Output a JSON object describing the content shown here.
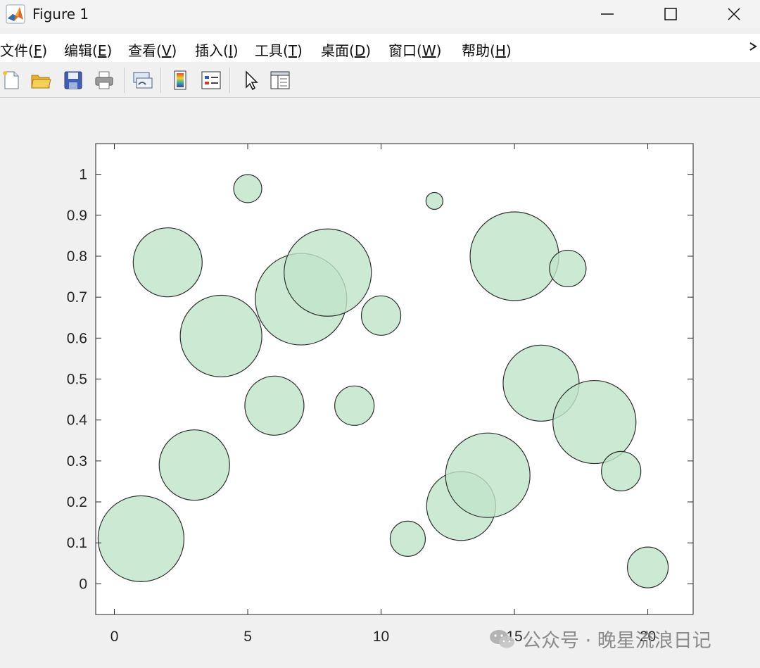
{
  "window": {
    "title": "Figure 1"
  },
  "menu": [
    {
      "label": "文件(",
      "acc": "F",
      "tail": ")"
    },
    {
      "label": "编辑(",
      "acc": "E",
      "tail": ")"
    },
    {
      "label": "查看(",
      "acc": "V",
      "tail": ")"
    },
    {
      "label": "插入(",
      "acc": "I",
      "tail": ")"
    },
    {
      "label": "工具(",
      "acc": "T",
      "tail": ")"
    },
    {
      "label": "桌面(",
      "acc": "D",
      "tail": ")"
    },
    {
      "label": "窗口(",
      "acc": "W",
      "tail": ")"
    },
    {
      "label": "帮助(",
      "acc": "H",
      "tail": ")"
    }
  ],
  "toolbar_icons": [
    "new-figure-icon",
    "open-file-icon",
    "save-icon",
    "print-icon",
    "link-plot-icon",
    "colorbar-icon",
    "legend-icon",
    "pointer-icon",
    "property-editor-icon"
  ],
  "watermark": "公众号 · 晚星流浪日记",
  "colors": {
    "bubble_fill": "#bfe3c9",
    "bubble_edge": "#1a1a1a",
    "axes_bg": "#ffffff",
    "figure_bg": "#f0f0f0"
  },
  "chart_data": {
    "type": "scatter",
    "title": "",
    "xlabel": "",
    "ylabel": "",
    "xlim": [
      -0.7,
      21.7
    ],
    "ylim": [
      -0.075,
      1.075
    ],
    "xticks": [
      0,
      5,
      10,
      15,
      20
    ],
    "yticks": [
      0,
      0.1,
      0.2,
      0.3,
      0.4,
      0.5,
      0.6,
      0.7,
      0.8,
      0.9,
      1
    ],
    "ytick_labels": [
      "0",
      "0.1",
      "0.2",
      "0.3",
      "0.4",
      "0.5",
      "0.6",
      "0.7",
      "0.8",
      "0.9",
      "1"
    ],
    "grid": false,
    "marker_alpha": 0.8,
    "points": [
      {
        "x": 1,
        "y": 0.11,
        "size": 61
      },
      {
        "x": 2,
        "y": 0.785,
        "size": 49
      },
      {
        "x": 3,
        "y": 0.29,
        "size": 50
      },
      {
        "x": 4,
        "y": 0.605,
        "size": 58
      },
      {
        "x": 5,
        "y": 0.965,
        "size": 20
      },
      {
        "x": 6,
        "y": 0.435,
        "size": 42
      },
      {
        "x": 7,
        "y": 0.695,
        "size": 65
      },
      {
        "x": 8,
        "y": 0.76,
        "size": 62
      },
      {
        "x": 9,
        "y": 0.435,
        "size": 28
      },
      {
        "x": 10,
        "y": 0.655,
        "size": 28
      },
      {
        "x": 11,
        "y": 0.11,
        "size": 25
      },
      {
        "x": 12,
        "y": 0.935,
        "size": 12
      },
      {
        "x": 13,
        "y": 0.19,
        "size": 49
      },
      {
        "x": 14,
        "y": 0.265,
        "size": 60
      },
      {
        "x": 15,
        "y": 0.8,
        "size": 63
      },
      {
        "x": 16,
        "y": 0.49,
        "size": 54
      },
      {
        "x": 17,
        "y": 0.77,
        "size": 26
      },
      {
        "x": 18,
        "y": 0.395,
        "size": 59
      },
      {
        "x": 19,
        "y": 0.275,
        "size": 28
      },
      {
        "x": 20,
        "y": 0.04,
        "size": 29
      }
    ]
  }
}
